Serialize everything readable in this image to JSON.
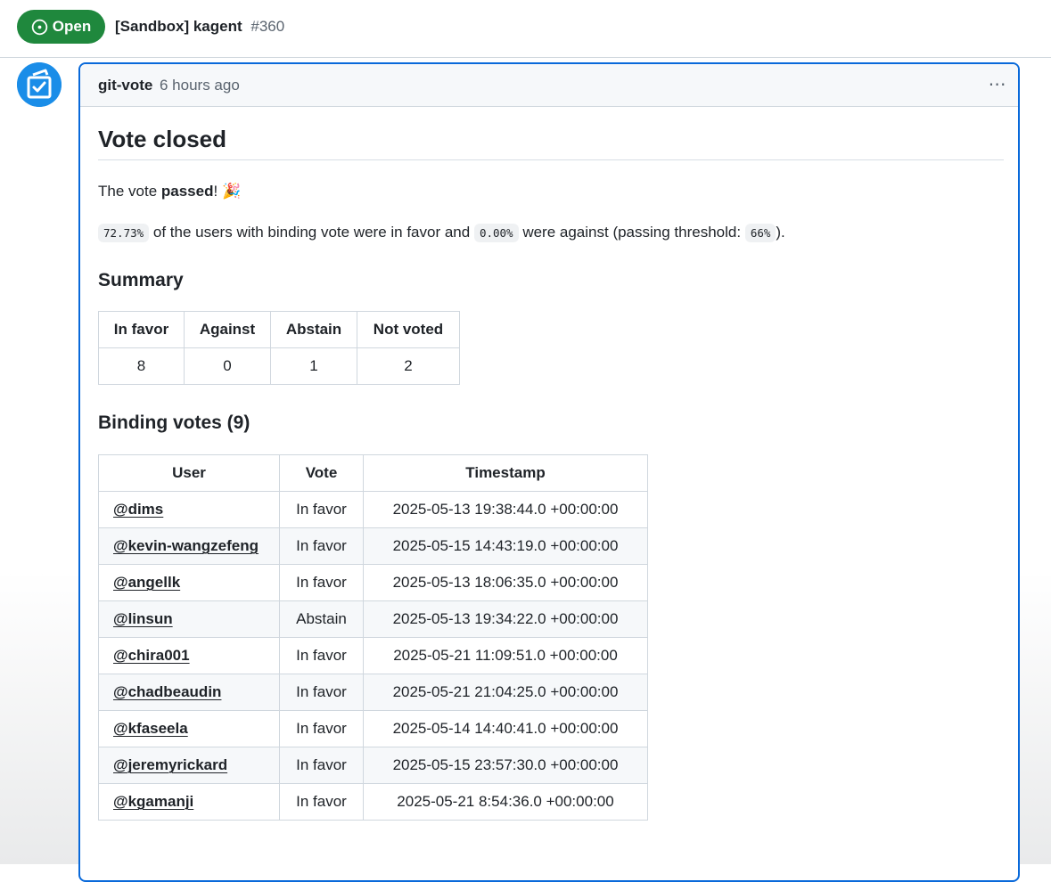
{
  "header": {
    "state_label": "Open",
    "title": "[Sandbox] kagent",
    "number": "#360",
    "accent_color": "#1f883d"
  },
  "comment": {
    "author": "git-vote",
    "time": "6 hours ago",
    "menu_icon": "kebab-horizontal-icon",
    "heading": "Vote closed",
    "result_prefix": "The vote",
    "result_word": "passed",
    "result_suffix": "!",
    "result_emoji": "🎉",
    "stats": {
      "in_favor_pct": "72.73%",
      "text_1": "of the users with binding vote were in favor and",
      "against_pct": "0.00%",
      "text_2": "were against (passing threshold:",
      "threshold": "66%",
      "text_3": ")."
    },
    "summary_heading": "Summary",
    "summary_table": {
      "headers": [
        "In favor",
        "Against",
        "Abstain",
        "Not voted"
      ],
      "values": [
        "8",
        "0",
        "1",
        "2"
      ]
    },
    "binding_heading": "Binding votes (9)",
    "votes_table": {
      "headers": [
        "User",
        "Vote",
        "Timestamp"
      ],
      "rows": [
        {
          "user": "@dims",
          "vote": "In favor",
          "timestamp": "2025-05-13 19:38:44.0 +00:00:00"
        },
        {
          "user": "@kevin-wangzefeng",
          "vote": "In favor",
          "timestamp": "2025-05-15 14:43:19.0 +00:00:00"
        },
        {
          "user": "@angellk",
          "vote": "In favor",
          "timestamp": "2025-05-13 18:06:35.0 +00:00:00"
        },
        {
          "user": "@linsun",
          "vote": "Abstain",
          "timestamp": "2025-05-13 19:34:22.0 +00:00:00"
        },
        {
          "user": "@chira001",
          "vote": "In favor",
          "timestamp": "2025-05-21 11:09:51.0 +00:00:00"
        },
        {
          "user": "@chadbeaudin",
          "vote": "In favor",
          "timestamp": "2025-05-21 21:04:25.0 +00:00:00"
        },
        {
          "user": "@kfaseela",
          "vote": "In favor",
          "timestamp": "2025-05-14 14:40:41.0 +00:00:00"
        },
        {
          "user": "@jeremyrickard",
          "vote": "In favor",
          "timestamp": "2025-05-15 23:57:30.0 +00:00:00"
        },
        {
          "user": "@kgamanji",
          "vote": "In favor",
          "timestamp": "2025-05-21 8:54:36.0 +00:00:00"
        }
      ]
    }
  }
}
